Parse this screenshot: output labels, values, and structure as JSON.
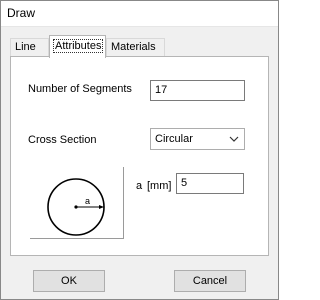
{
  "window": {
    "title": "Draw"
  },
  "tabs": [
    "Line",
    "Attributes",
    "Materials"
  ],
  "form": {
    "segments_label": "Number of Segments",
    "segments_value": "17",
    "cross_section_label": "Cross Section",
    "cross_section_value": "Circular",
    "a_label": "a",
    "a_unit": "[mm]",
    "a_value": "5",
    "diagram_label": "a"
  },
  "buttons": {
    "ok": "OK",
    "cancel": "Cancel"
  },
  "icons": {
    "dropdown": "chevron-down-icon",
    "cross_section": "circle-cross-section-icon"
  }
}
